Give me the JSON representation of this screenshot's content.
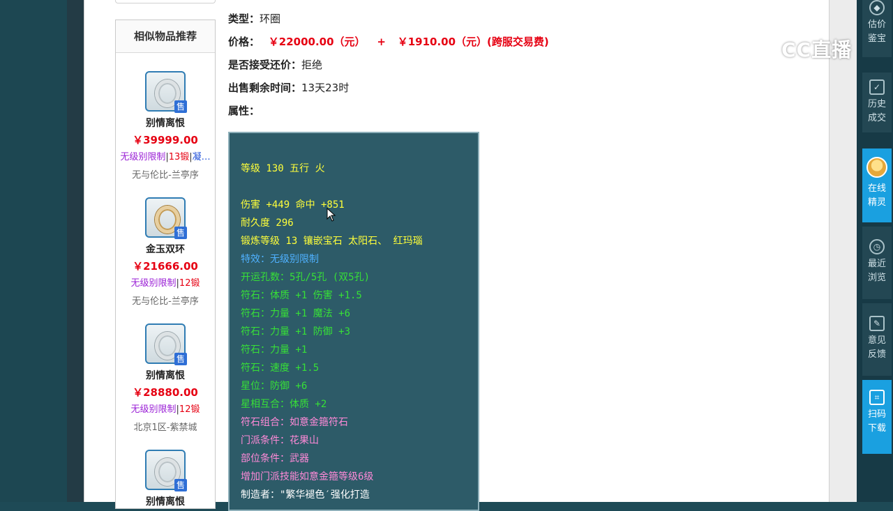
{
  "recommend": {
    "title": "相似物品推荐",
    "items": [
      {
        "name": "别情离恨",
        "price": "￥39999.00",
        "tag1": "无级别限制",
        "tag2": "13锻",
        "tag3": "凝…",
        "server": "无与伦比-兰亭序",
        "badge": "售",
        "icon": "ring-silver-icon"
      },
      {
        "name": "金玉双环",
        "price": "￥21666.00",
        "tag1": "无级别限制",
        "tag2": "12锻",
        "server": "无与伦比-兰亭序",
        "badge": "售",
        "icon": "ring-gold-icon"
      },
      {
        "name": "别情离恨",
        "price": "￥28880.00",
        "tag1": "无级别限制",
        "tag2": "12锻",
        "server": "北京1区-紫禁城",
        "badge": "售",
        "icon": "ring-silver-icon"
      },
      {
        "name": "别情离恨",
        "price": "",
        "tag1": "",
        "tag2": "",
        "server": "",
        "badge": "售",
        "icon": "ring-silver-icon"
      }
    ]
  },
  "detail": {
    "type_label": "类型：",
    "type_value": "环圈",
    "price_label": "价格：",
    "price_value": "￥22000.00（元）",
    "price_plus": "+",
    "fee_value": "￥1910.00（元）(跨服交易费)",
    "bargain_label": "是否接受还价：",
    "bargain_value": "拒绝",
    "remaining_label": "出售剩余时间：",
    "remaining_value": "13天23时",
    "attr_label": "属性："
  },
  "attributes": {
    "level": "等级 130 五行 火",
    "damage": "伤害 +449 命中 +851",
    "durability": "耐久度 296",
    "forge": "锻炼等级 13 镶嵌宝石 太阳石、 红玛瑙",
    "special": "特效：无级别限制",
    "holes": "开运孔数：5孔/5孔 (双5孔)",
    "rune1": "符石：体质 +1 伤害 +1.5",
    "rune2": "符石：力量 +1 魔法 +6",
    "rune3": "符石：力量 +1 防御 +3",
    "rune4": "符石：力量 +1",
    "rune5": "符石：速度 +1.5",
    "star": "星位：防御 +6",
    "star_match": "星相互合：体质 +2",
    "rune_combo": "符石组合：如意金箍符石",
    "school_req": "门派条件：花果山",
    "slot_req": "部位条件：武器",
    "skill_add": "增加门派技能如意金箍等级6级",
    "maker": "制造者：\"繁华褪色′强化打造"
  },
  "toolbar": {
    "appraise": "估价\n鉴宝",
    "history": "历史\n成交",
    "online": "在线\n精灵",
    "recent": "最近\n浏览",
    "feedback": "意见\n反馈",
    "scan": "扫码\n下载"
  },
  "watermark": {
    "text": "CC直播"
  },
  "colors": {
    "price_red": "#e60012",
    "attr_bg": "#2d5b68",
    "active_tool": "#1aa0e0"
  }
}
